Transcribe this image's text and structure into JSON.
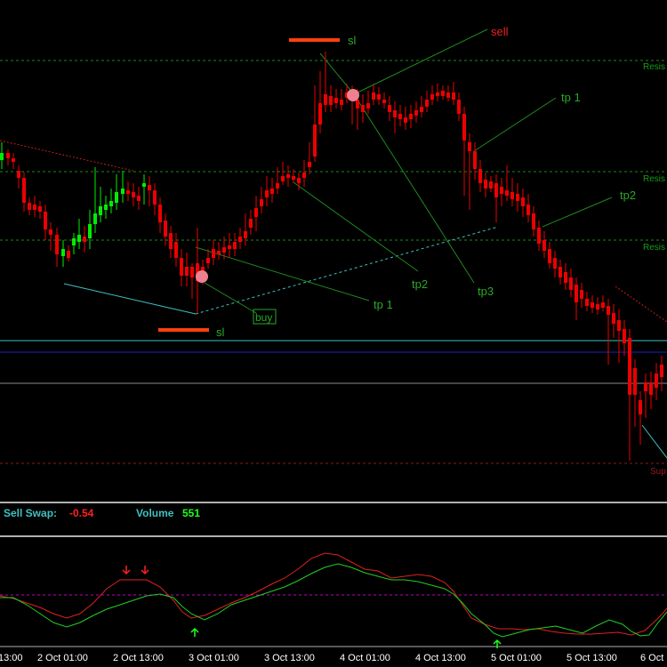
{
  "colors": {
    "background": "#000000",
    "bull": "#00ee00",
    "bear": "#ee0000",
    "resistance": "#1a8a1a",
    "support": "#8a1a1a",
    "cyan_line": "#40c0c0",
    "blue_line": "#2020c0",
    "gray_line": "#8a8a8a",
    "sl_bar": "#ff4010",
    "signal_line": "#1f8a1f",
    "signal_text": "#2aa82a",
    "oscillator_green": "#20d020",
    "oscillator_red": "#e02020",
    "oscillator_level": "#c000c0"
  },
  "levels": {
    "resistance_1": "Resis",
    "resistance_2": "Resis",
    "resistance_3": "Resis",
    "support_1": "Sup"
  },
  "trade_labels": {
    "sell": "sell",
    "sl_top": "sl",
    "sl_bottom": "sl",
    "buy": "buy",
    "tp1_upper": "tp 1",
    "tp2_upper": "tp2",
    "tp3": "tp3",
    "tp2_lower": "tp2",
    "tp1_lower": "tp 1"
  },
  "info_bar": {
    "sell_swap_label": "Sell Swap:",
    "sell_swap_value": "-0.54",
    "volume_label": "Volume",
    "volume_value": "551"
  },
  "time_axis": [
    "13:00",
    "2 Oct 01:00",
    "2 Oct 13:00",
    "3 Oct 01:00",
    "3 Oct 13:00",
    "4 Oct 01:00",
    "4 Oct 13:00",
    "5 Oct 01:00",
    "5 Oct 13:00",
    "6 Oct"
  ]
}
